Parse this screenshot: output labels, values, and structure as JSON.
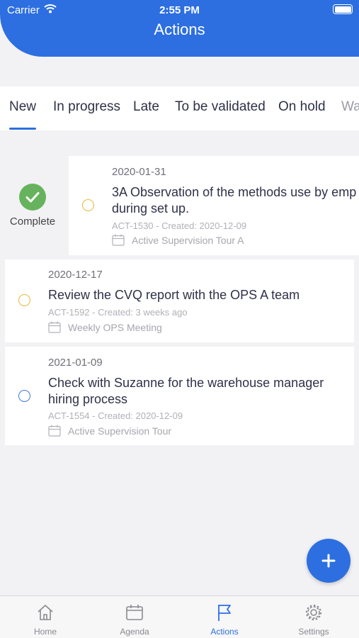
{
  "status_bar": {
    "carrier": "Carrier",
    "time": "2:55 PM"
  },
  "header": {
    "title": "Actions"
  },
  "tabs": [
    {
      "label": "New",
      "selected": true
    },
    {
      "label": "In progress",
      "selected": false
    },
    {
      "label": "Late",
      "selected": false
    },
    {
      "label": "To be validated",
      "selected": false
    },
    {
      "label": "On hold",
      "selected": false
    },
    {
      "label": "Wa",
      "selected": false
    }
  ],
  "swipe_action": {
    "label": "Complete",
    "color": "#67b35d"
  },
  "actions": [
    {
      "date": "2020-01-31",
      "title_line1": "3A Observation of the methods use by emp",
      "title_line2": "during set up.",
      "meta": "ACT-1530 - Created: 2020-12-09",
      "source": "Active Supervision Tour A",
      "status_color": "#e5b93c"
    },
    {
      "date": "2020-12-17",
      "title_line1": "Review the CVQ report with the OPS A team",
      "title_line2": "",
      "meta": "ACT-1592 - Created: 3 weeks ago",
      "source": "Weekly OPS Meeting",
      "status_color": "#e5b93c"
    },
    {
      "date": "2021-01-09",
      "title_line1": "Check with Suzanne for the warehouse manager",
      "title_line2": "hiring process",
      "meta": "ACT-1554 - Created: 2020-12-09",
      "source": "Active Supervision Tour",
      "status_color": "#3d7ae0"
    }
  ],
  "tabbar": [
    {
      "label": "Home",
      "icon": "home-icon"
    },
    {
      "label": "Agenda",
      "icon": "calendar-icon"
    },
    {
      "label": "Actions",
      "icon": "flag-icon",
      "active": true
    },
    {
      "label": "Settings",
      "icon": "gear-icon"
    }
  ],
  "colors": {
    "accent": "#2d6fe0",
    "complete": "#67b35d",
    "pending": "#e5b93c",
    "new": "#3d7ae0"
  }
}
